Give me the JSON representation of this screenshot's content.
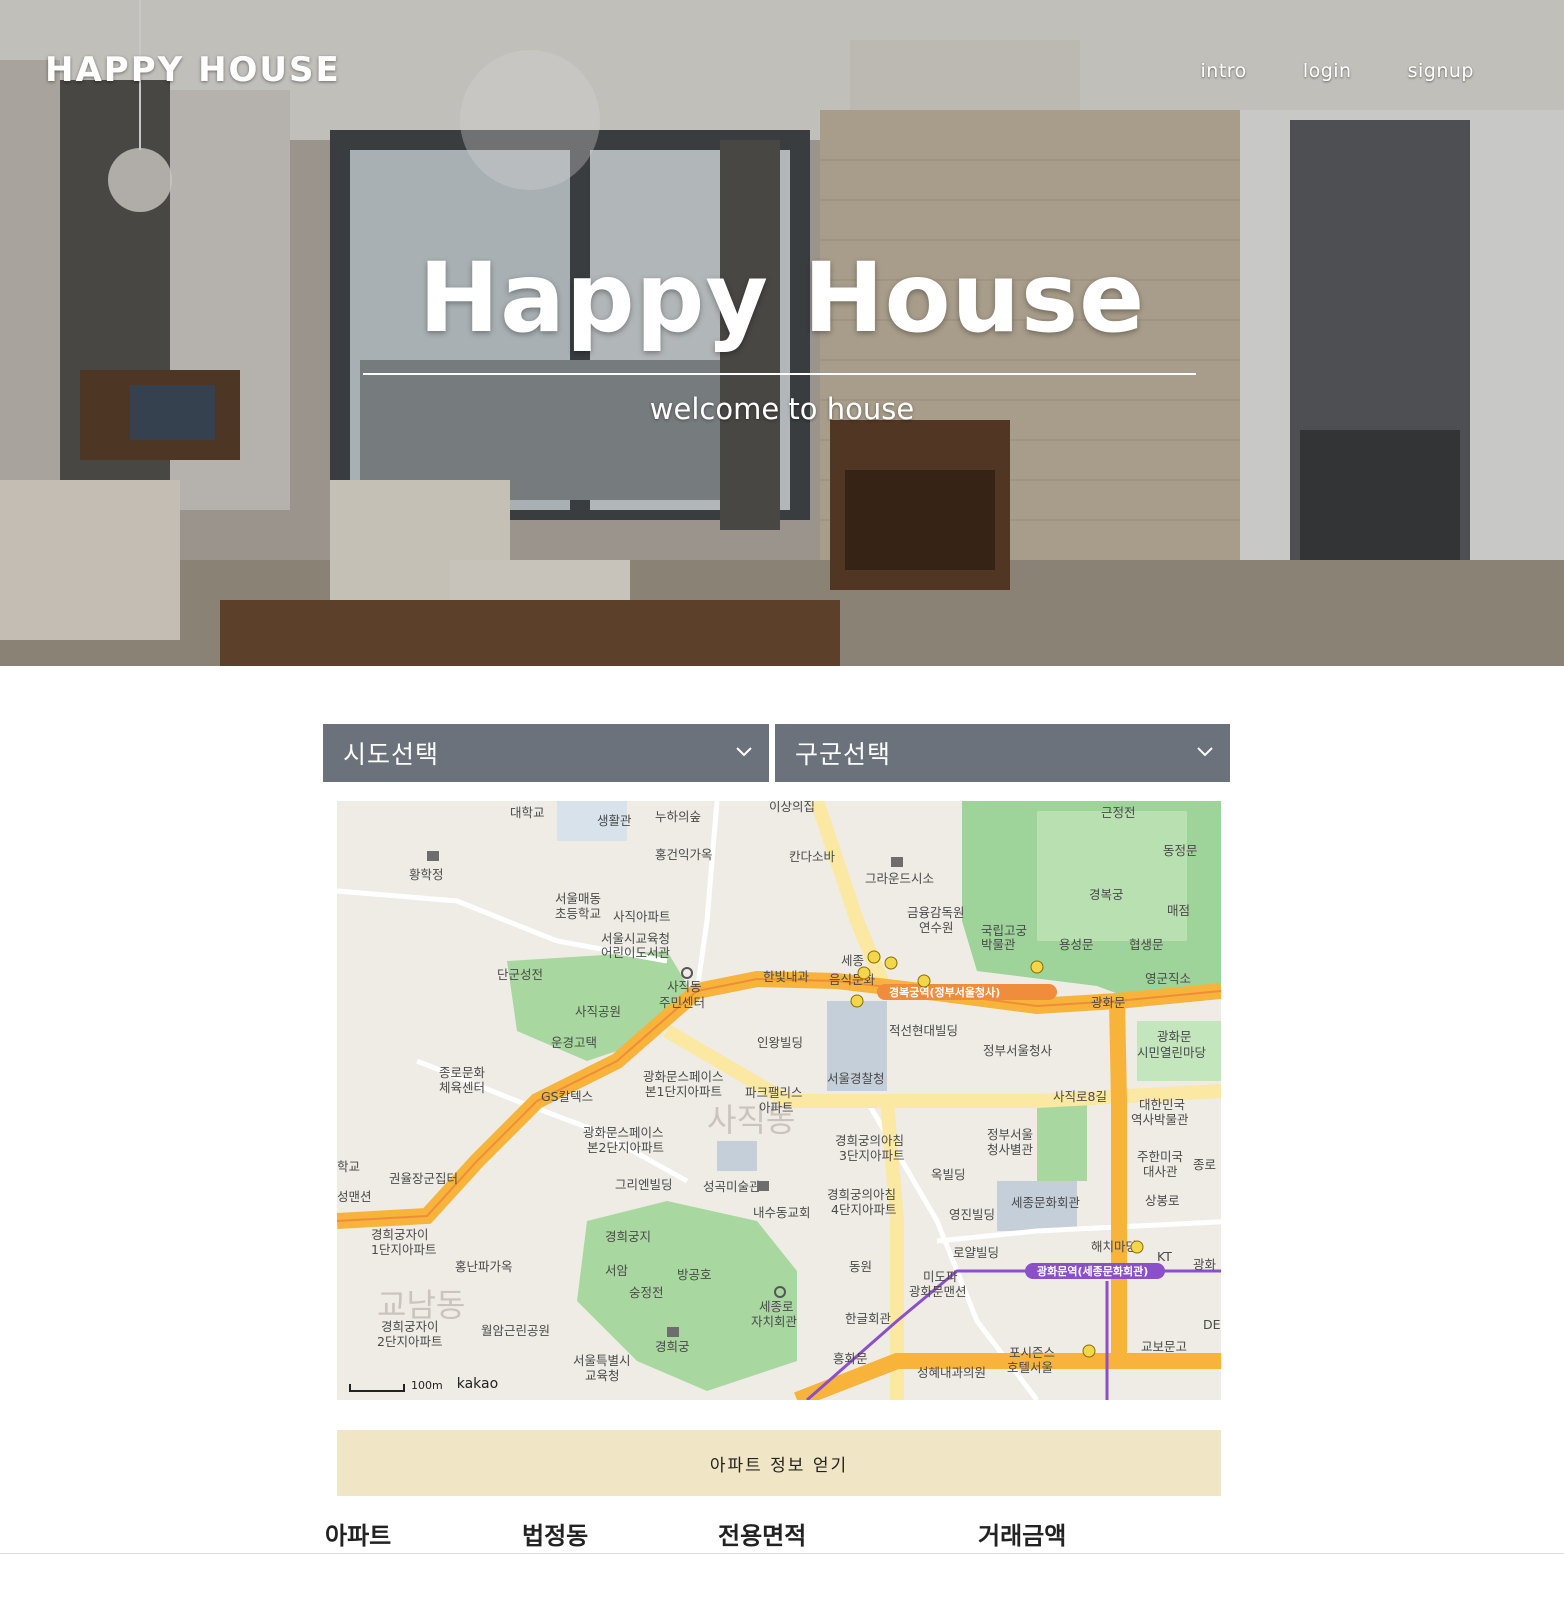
{
  "header": {
    "brand": "HAPPY HOUSE",
    "nav": [
      {
        "label": "intro"
      },
      {
        "label": "login"
      },
      {
        "label": "signup"
      }
    ]
  },
  "hero": {
    "title": "Happy House",
    "subtitle": "welcome to house"
  },
  "filters": {
    "sido": {
      "selected": "시도선택"
    },
    "gugun": {
      "selected": "구군선택"
    }
  },
  "map": {
    "provider": "kakao",
    "scale_label": "100m",
    "labels": {
      "l1": "대학교",
      "l2": "생활관",
      "l3": "누하의숲",
      "l4": "이상의집",
      "l5": "근정전",
      "l6": "황학정",
      "l7": "홍건익가옥",
      "l8": "칸다소바",
      "l9": "그라운드시소",
      "l10": "동정문",
      "l11": "서울매동",
      "l12": "초등학교",
      "l13": "사직아파트",
      "l14": "경복궁",
      "l15": "매점",
      "l16": "금융감독원",
      "l17": "연수원",
      "l18": "서울시교육청",
      "l19": "어린이도서관",
      "l20": "국립고궁",
      "l21": "박물관",
      "l22": "용성문",
      "l23": "협생문",
      "l24": "단군성전",
      "l25": "사직동",
      "l26": "주민센터",
      "l27": "한빛내과",
      "l28": "세종",
      "l29": "음식문화",
      "l30": "영군직소",
      "l31": "사직공원",
      "l32": "경복궁역(정부서울청사)",
      "l33": "광화문",
      "l34": "운경고택",
      "l35": "적선현대빌딩",
      "l36": "인왕빌딩",
      "l37": "정부서울청사",
      "l38": "광화문",
      "l39": "시민열린마당",
      "l40": "종로문화",
      "l41": "체육센터",
      "l42": "GS칼텍스",
      "l43": "광화문스페이스",
      "l44": "본1단지아파트",
      "l45": "파크팰리스",
      "l46": "아파트",
      "l47": "서울경찰청",
      "l48": "대한민국",
      "l49": "역사박물관",
      "l50": "사직동",
      "l51": "사직로8길",
      "l52": "광화문스페이스",
      "l53": "본2단지아파트",
      "l54": "경희궁의아침",
      "l55": "3단지아파트",
      "l56": "정부서울",
      "l57": "청사별관",
      "l58": "주한미국",
      "l59": "대사관",
      "l60": "종로",
      "l61": "학교",
      "l62": "권율장군집터",
      "l63": "그리엔빌딩",
      "l64": "성곡미술관",
      "l65": "옥빌딩",
      "l66": "성맨션",
      "l67": "경희궁의아침",
      "l68": "4단지아파트",
      "l69": "내수동교회",
      "l70": "영진빌딩",
      "l71": "세종문화회관",
      "l72": "상봉로",
      "l73": "경희궁자이",
      "l74": "1단지아파트",
      "l75": "경희궁지",
      "l76": "로얄빌딩",
      "l77": "해치마당",
      "l78": "KT",
      "l79": "홍난파가옥",
      "l80": "서암",
      "l81": "방공호",
      "l82": "동원",
      "l83": "미도파",
      "l84": "광화문맨션",
      "l85": "광화문역(세종문화회관)",
      "l86": "광화",
      "l87": "숭정전",
      "l88": "세종로",
      "l89": "자치회관",
      "l90": "교남동",
      "l91": "경희궁자이",
      "l92": "2단지아파트",
      "l93": "월암근린공원",
      "l94": "경희궁",
      "l95": "한글회관",
      "l96": "DE",
      "l97": "교보문고",
      "l98": "서울특별시",
      "l99": "교육청",
      "l100": "흥화문",
      "l101": "포시즌스",
      "l102": "호텔서울",
      "l103": "성혜내과의원",
      "l104": "홍화문"
    }
  },
  "actions": {
    "get_apt": "아파트 정보 얻기"
  },
  "table": {
    "columns": [
      "아파트",
      "법정동",
      "전용면적",
      "거래금액"
    ]
  }
}
